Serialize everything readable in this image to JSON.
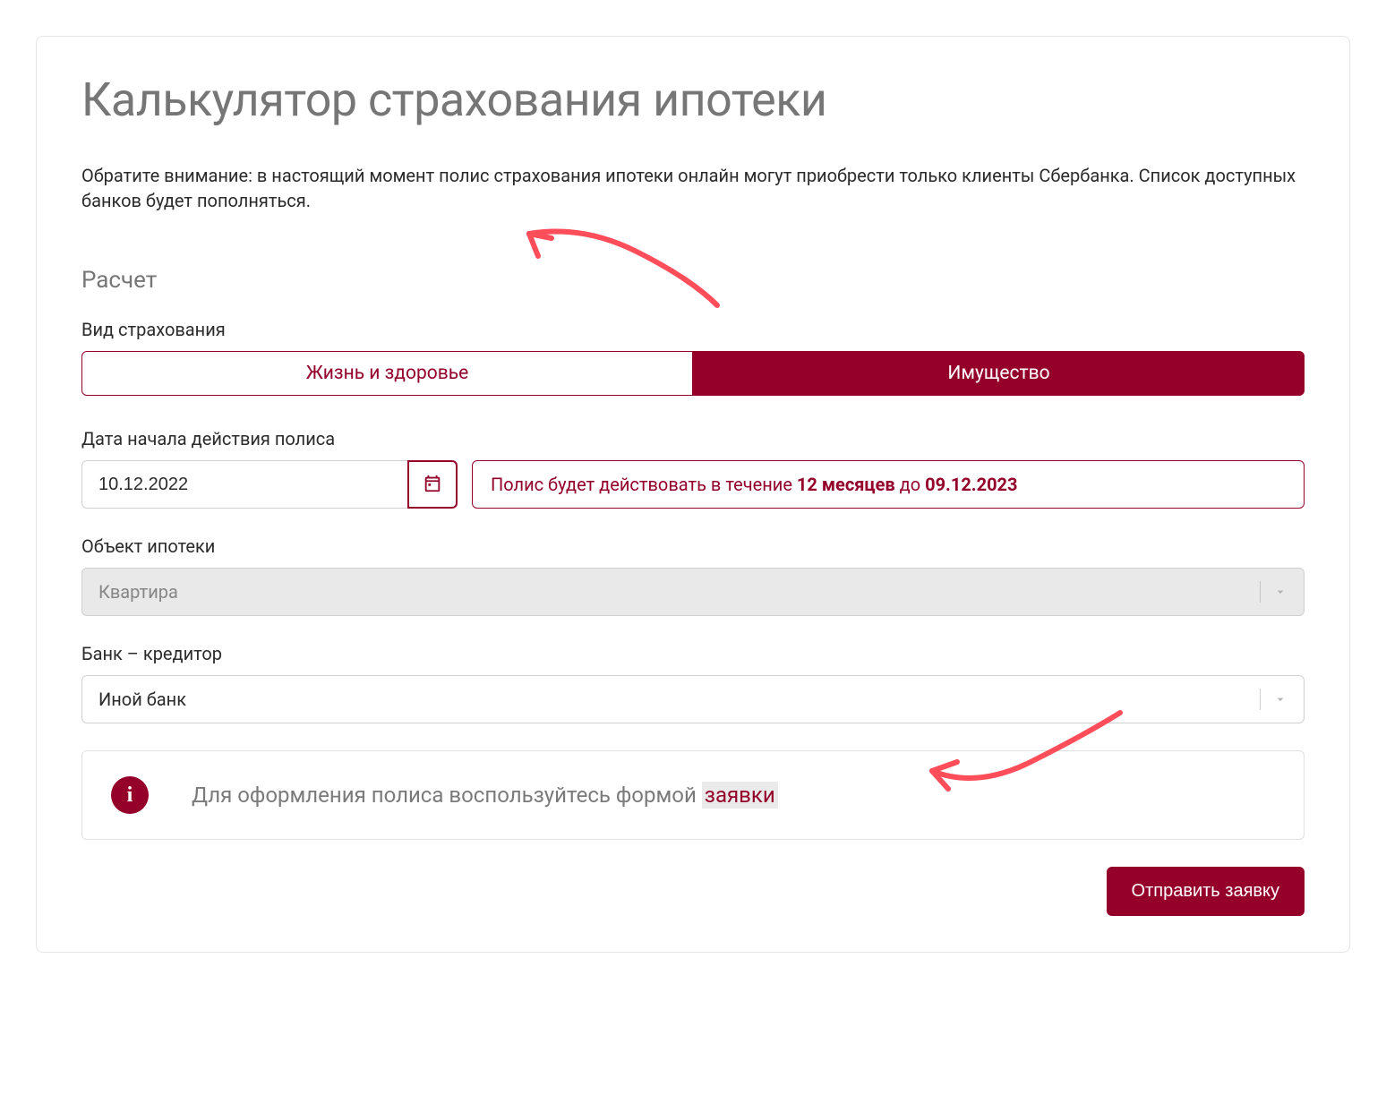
{
  "title": "Калькулятор страхования ипотеки",
  "notice": "Обратите внимание: в настоящий момент полис страхования ипотеки онлайн могут приобрести только клиенты Сбербанка. Список доступных банков будет пополняться.",
  "section_heading": "Расчет",
  "insurance_type": {
    "label": "Вид страхования",
    "options": [
      "Жизнь и здоровье",
      "Имущество"
    ],
    "active_index": 1
  },
  "policy_date": {
    "label": "Дата начала действия полиса",
    "value": "10.12.2022",
    "validity_prefix": "Полис будет действовать в течение ",
    "validity_duration": "12 месяцев",
    "validity_middle": " до ",
    "validity_end": "09.12.2023"
  },
  "mortgage_object": {
    "label": "Объект ипотеки",
    "value": "Квартира",
    "disabled": true
  },
  "bank": {
    "label": "Банк – кредитор",
    "value": "Иной банк",
    "disabled": false
  },
  "info_banner": {
    "text_prefix": "Для оформления полиса воспользуйтесь формой ",
    "link_text": "заявки"
  },
  "submit_label": "Отправить заявку",
  "colors": {
    "accent": "#94002a",
    "arrow": "#ff4d5a"
  }
}
